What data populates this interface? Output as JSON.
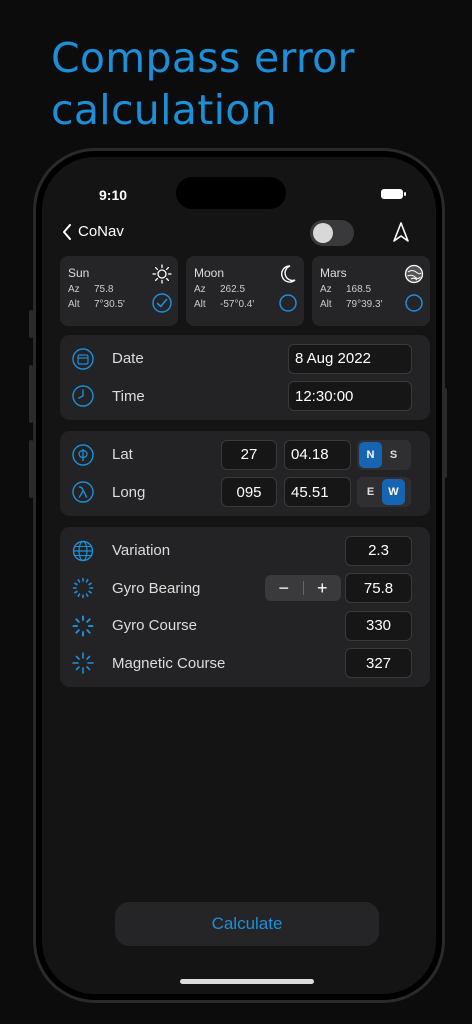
{
  "headline": {
    "line1": "Compass error",
    "line2": "calculation"
  },
  "status": {
    "time": "9:10"
  },
  "nav": {
    "back_label": "CoNav"
  },
  "bodies": [
    {
      "name": "Sun",
      "az_label": "Az",
      "az": "75.8",
      "alt_label": "Alt",
      "alt": "7°30.5'",
      "icon": "sun-icon",
      "selected": true
    },
    {
      "name": "Moon",
      "az_label": "Az",
      "az": "262.5",
      "alt_label": "Alt",
      "alt": "-57°0.4'",
      "icon": "moon-icon",
      "selected": false
    },
    {
      "name": "Mars",
      "az_label": "Az",
      "az": "168.5",
      "alt_label": "Alt",
      "alt": "79°39.3'",
      "icon": "mars-icon",
      "selected": false
    }
  ],
  "datetime": {
    "date_label": "Date",
    "date_value": "8 Aug 2022",
    "time_label": "Time",
    "time_value": "12:30:00"
  },
  "position": {
    "lat_label": "Lat",
    "lat_deg": "27",
    "lat_min": "04.18",
    "lat_n": "N",
    "lat_s": "S",
    "lat_selected": "N",
    "long_label": "Long",
    "long_deg": "095",
    "long_min": "45.51",
    "long_e": "E",
    "long_w": "W",
    "long_selected": "W"
  },
  "courses": {
    "variation_label": "Variation",
    "variation_value": "2.3",
    "gyro_bearing_label": "Gyro Bearing",
    "gyro_bearing_value": "75.8",
    "stepper_minus": "−",
    "stepper_plus": "+",
    "gyro_course_label": "Gyro Course",
    "gyro_course_value": "330",
    "magnetic_course_label": "Magnetic Course",
    "magnetic_course_value": "327"
  },
  "calculate_label": "Calculate",
  "colors": {
    "accent": "#1c8fd9",
    "selected_segment": "#1565b3",
    "background": "#141415",
    "panel": "#232325"
  }
}
